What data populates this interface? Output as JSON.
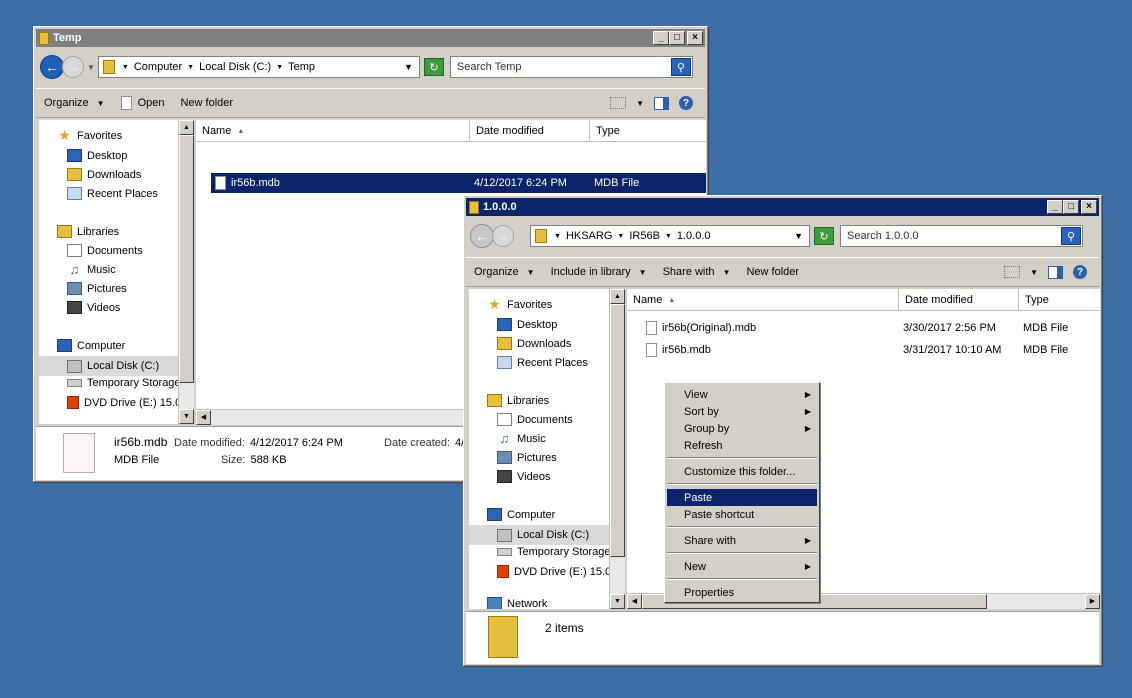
{
  "windows": [
    {
      "title": "Temp",
      "path": [
        "Computer",
        "Local Disk (C:)",
        "Temp"
      ],
      "search_placeholder": "Search Temp",
      "toolbar": {
        "organize": "Organize",
        "open": "Open",
        "new_folder": "New folder"
      },
      "columns": {
        "name": "Name",
        "date": "Date modified",
        "type": "Type"
      },
      "files": [
        {
          "name": "ir56b.mdb",
          "date": "4/12/2017 6:24 PM",
          "type": "MDB File"
        }
      ],
      "nav": {
        "favorites": "Favorites",
        "desktop": "Desktop",
        "downloads": "Downloads",
        "recent": "Recent Places",
        "libraries": "Libraries",
        "documents": "Documents",
        "music": "Music",
        "pictures": "Pictures",
        "videos": "Videos",
        "computer": "Computer",
        "local_disk": "Local Disk (C:)",
        "temp_storage": "Temporary Storage",
        "dvd": "DVD Drive (E:) 15.0"
      },
      "details": {
        "name": "ir56b.mdb",
        "type": "MDB File",
        "date_modified_label": "Date modified:",
        "date_modified": "4/12/2017 6:24 PM",
        "size_label": "Size:",
        "size": "588 KB",
        "date_created_label": "Date created:",
        "date_created": "4/"
      }
    },
    {
      "title": "1.0.0.0",
      "path": [
        "HKSARG",
        "IR56B",
        "1.0.0.0"
      ],
      "search_placeholder": "Search 1.0.0.0",
      "toolbar": {
        "organize": "Organize",
        "include": "Include in library",
        "share": "Share with",
        "new_folder": "New folder"
      },
      "columns": {
        "name": "Name",
        "date": "Date modified",
        "type": "Type"
      },
      "files": [
        {
          "name": "ir56b(Original).mdb",
          "date": "3/30/2017 2:56 PM",
          "type": "MDB File"
        },
        {
          "name": "ir56b.mdb",
          "date": "3/31/2017 10:10 AM",
          "type": "MDB File"
        }
      ],
      "nav": {
        "favorites": "Favorites",
        "desktop": "Desktop",
        "downloads": "Downloads",
        "recent": "Recent Places",
        "libraries": "Libraries",
        "documents": "Documents",
        "music": "Music",
        "pictures": "Pictures",
        "videos": "Videos",
        "computer": "Computer",
        "local_disk": "Local Disk (C:)",
        "temp_storage": "Temporary Storage",
        "dvd": "DVD Drive (E:) 15.0",
        "network": "Network"
      },
      "details": {
        "count": "2 items"
      }
    }
  ],
  "context_menu": {
    "items": [
      {
        "label": "View",
        "submenu": true
      },
      {
        "label": "Sort by",
        "submenu": true
      },
      {
        "label": "Group by",
        "submenu": true
      },
      {
        "label": "Refresh",
        "submenu": false
      },
      {
        "label": "Customize this folder...",
        "submenu": false
      },
      {
        "label": "Paste",
        "submenu": false,
        "highlighted": true
      },
      {
        "label": "Paste shortcut",
        "submenu": false
      },
      {
        "label": "Share with",
        "submenu": true
      },
      {
        "label": "New",
        "submenu": true
      },
      {
        "label": "Properties",
        "submenu": false
      }
    ]
  },
  "colors": {
    "desktop": "#3a6ea5",
    "active_title": "#0a246a",
    "inactive_title": "#808080",
    "selection": "#0a246a"
  }
}
